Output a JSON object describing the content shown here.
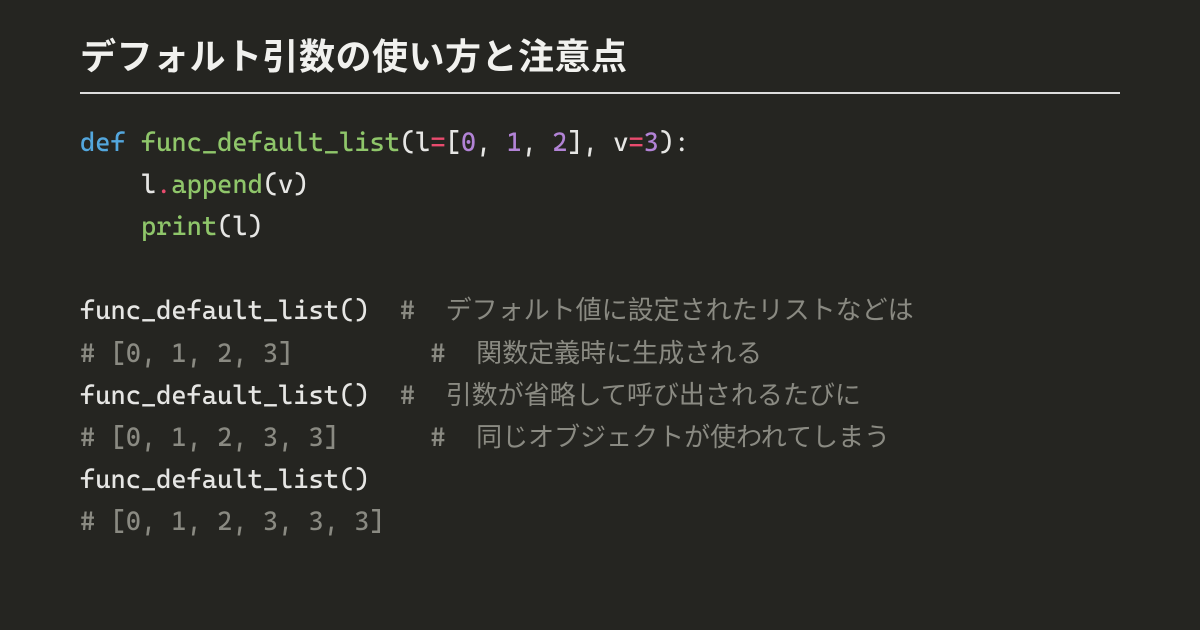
{
  "title": "デフォルト引数の使い方と注意点",
  "code": {
    "l1": {
      "def": "def",
      "sp1": " ",
      "fn": "func_default_list",
      "open": "(l",
      "eq1": "=",
      "lb": "[",
      "n0": "0",
      "c1": ", ",
      "n1": "1",
      "c2": ", ",
      "n2": "2",
      "rb": "]",
      "cm": ", v",
      "eq2": "=",
      "n3": "3",
      "close": "):"
    },
    "l2": {
      "indent": "    l",
      "dot": ".",
      "ap": "append",
      "args": "(v)"
    },
    "l3": {
      "indent": "    ",
      "pr": "print",
      "args": "(l)"
    },
    "l4": "",
    "l5": {
      "call": "func_default_list()",
      "pad": "  ",
      "cm": "#  デフォルト値に設定されたリストなどは"
    },
    "l6": {
      "out": "# [0, 1, 2, 3]",
      "pad": "         ",
      "cm": "#  関数定義時に生成される"
    },
    "l7": {
      "call": "func_default_list()",
      "pad": "  ",
      "cm": "#  引数が省略して呼び出されるたびに"
    },
    "l8": {
      "out": "# [0, 1, 2, 3, 3]",
      "pad": "      ",
      "cm": "#  同じオブジェクトが使われてしまう"
    },
    "l9": {
      "call": "func_default_list()"
    },
    "l10": {
      "out": "# [0, 1, 2, 3, 3, 3]"
    }
  }
}
